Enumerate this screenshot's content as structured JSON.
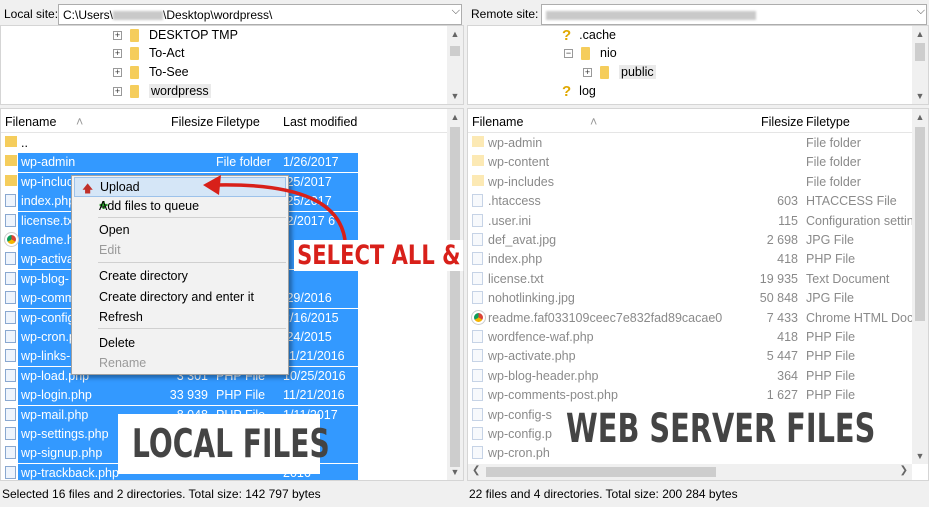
{
  "left": {
    "site_label": "Local site:",
    "site_path_start": "C:\\Users\\",
    "site_path_end": "\\Desktop\\wordpress\\",
    "tree": [
      "DESKTOP TMP",
      "To-Act",
      "To-See",
      "wordpress"
    ],
    "headers": {
      "filename": "Filename",
      "filesize": "Filesize",
      "filetype": "Filetype",
      "modified": "Last modified"
    },
    "rows": [
      {
        "name": "..",
        "size": "",
        "type": "",
        "modified": "",
        "icon": "folder-icon",
        "selected": false
      },
      {
        "name": "wp-admin",
        "size": "",
        "type": "File folder",
        "modified": "1/26/2017",
        "icon": "folder-icon",
        "selected": true
      },
      {
        "name": "wp-includ",
        "size": "",
        "type": "",
        "modified": "/25/2017",
        "icon": "folder-icon",
        "selected": true
      },
      {
        "name": "index.php",
        "size": "",
        "type": "",
        "modified": "/25/2017",
        "icon": "file-icon",
        "selected": true
      },
      {
        "name": "license.tx",
        "size": "",
        "type": "",
        "modified": "/2/2017 6",
        "icon": "file-icon",
        "selected": true
      },
      {
        "name": "readme.h",
        "size": "",
        "type": "",
        "modified": "",
        "icon": "chrome-icon",
        "selected": true
      },
      {
        "name": "wp-activa",
        "size": "",
        "type": "",
        "modified": "",
        "icon": "file-icon",
        "selected": true
      },
      {
        "name": "wp-blog-",
        "size": "",
        "type": "",
        "modified": "",
        "icon": "file-icon",
        "selected": true
      },
      {
        "name": "wp-comm",
        "size": "",
        "type": "",
        "modified": "/29/2016",
        "icon": "file-icon",
        "selected": true
      },
      {
        "name": "wp-config",
        "size": "",
        "type": "",
        "modified": "2/16/2015",
        "icon": "file-icon",
        "selected": true
      },
      {
        "name": "wp-cron.p",
        "size": "",
        "type": "",
        "modified": "/24/2015",
        "icon": "file-icon",
        "selected": true
      },
      {
        "name": "wp-links-",
        "size": "",
        "type": "",
        "modified": "11/21/2016",
        "icon": "file-icon",
        "selected": true
      },
      {
        "name": "wp-load.php",
        "size": "3 301",
        "type": "PHP File",
        "modified": "10/25/2016",
        "icon": "file-icon",
        "selected": true
      },
      {
        "name": "wp-login.php",
        "size": "33 939",
        "type": "PHP File",
        "modified": "11/21/2016",
        "icon": "file-icon",
        "selected": true
      },
      {
        "name": "wp-mail.php",
        "size": "8 048",
        "type": "PHP File",
        "modified": "1/11/2017",
        "icon": "file-icon",
        "selected": true
      },
      {
        "name": "wp-settings.php",
        "size": "",
        "type": "",
        "modified": "2016",
        "icon": "file-icon",
        "selected": true
      },
      {
        "name": "wp-signup.php",
        "size": "",
        "type": "",
        "modified": "2016",
        "icon": "file-icon",
        "selected": true
      },
      {
        "name": "wp-trackback.php",
        "size": "",
        "type": "",
        "modified": "2016",
        "icon": "file-icon",
        "selected": true
      }
    ],
    "status": "Selected 16 files and 2 directories. Total size: 142 797 bytes"
  },
  "menu": {
    "items": [
      {
        "label": "Upload",
        "icon": "upload-arrow-icon",
        "disabled": false,
        "hot": true
      },
      {
        "label": "Add files to queue",
        "icon": "add-queue-icon",
        "disabled": false,
        "hot": false
      },
      {
        "label": "Open",
        "disabled": false
      },
      {
        "label": "Edit",
        "disabled": true
      },
      {
        "label": "Create directory",
        "disabled": false
      },
      {
        "label": "Create directory and enter it",
        "disabled": false
      },
      {
        "label": "Refresh",
        "disabled": false
      },
      {
        "label": "Delete",
        "disabled": false
      },
      {
        "label": "Rename",
        "disabled": true
      }
    ]
  },
  "right": {
    "site_label": "Remote site:",
    "tree": [
      ".cache",
      "nio",
      "public",
      "log"
    ],
    "headers": {
      "filename": "Filename",
      "filesize": "Filesize",
      "filetype": "Filetype"
    },
    "rows": [
      {
        "name": "wp-admin",
        "size": "",
        "type": "File folder",
        "icon": "folder-icon"
      },
      {
        "name": "wp-content",
        "size": "",
        "type": "File folder",
        "icon": "folder-icon"
      },
      {
        "name": "wp-includes",
        "size": "",
        "type": "File folder",
        "icon": "folder-icon"
      },
      {
        "name": ".htaccess",
        "size": "603",
        "type": "HTACCESS File",
        "icon": "file-icon"
      },
      {
        "name": ".user.ini",
        "size": "115",
        "type": "Configuration settin",
        "icon": "file-icon"
      },
      {
        "name": "def_avat.jpg",
        "size": "2 698",
        "type": "JPG File",
        "icon": "file-icon"
      },
      {
        "name": "index.php",
        "size": "418",
        "type": "PHP File",
        "icon": "file-icon"
      },
      {
        "name": "license.txt",
        "size": "19 935",
        "type": "Text Document",
        "icon": "file-icon"
      },
      {
        "name": "nohotlinking.jpg",
        "size": "50 848",
        "type": "JPG File",
        "icon": "file-icon"
      },
      {
        "name": "readme.faf033109ceec7e832fad89cacae0",
        "size": "7 433",
        "type": "Chrome HTML Docu",
        "icon": "chrome-icon"
      },
      {
        "name": "wordfence-waf.php",
        "size": "418",
        "type": "PHP File",
        "icon": "file-icon"
      },
      {
        "name": "wp-activate.php",
        "size": "5 447",
        "type": "PHP File",
        "icon": "file-icon"
      },
      {
        "name": "wp-blog-header.php",
        "size": "364",
        "type": "PHP File",
        "icon": "file-icon"
      },
      {
        "name": "wp-comments-post.php",
        "size": "1 627",
        "type": "PHP File",
        "icon": "file-icon"
      },
      {
        "name": "wp-config-s",
        "size": "",
        "type": "",
        "icon": "file-icon"
      },
      {
        "name": "wp-config.p",
        "size": "",
        "type": "",
        "icon": "file-icon"
      },
      {
        "name": "wp-cron.ph",
        "size": "",
        "type": "",
        "icon": "file-icon"
      }
    ],
    "status": "22 files and 4 directories. Total size: 200 284 bytes"
  },
  "overlays": {
    "select_all": "SELECT ALL &",
    "local_files": "LOCAL FILES",
    "web_server_files": "WEB SERVER FILES",
    "arrow_color": "#d8201a"
  },
  "colors": {
    "selection": "#3399ff",
    "menu_hot": "#d5e6f7"
  }
}
